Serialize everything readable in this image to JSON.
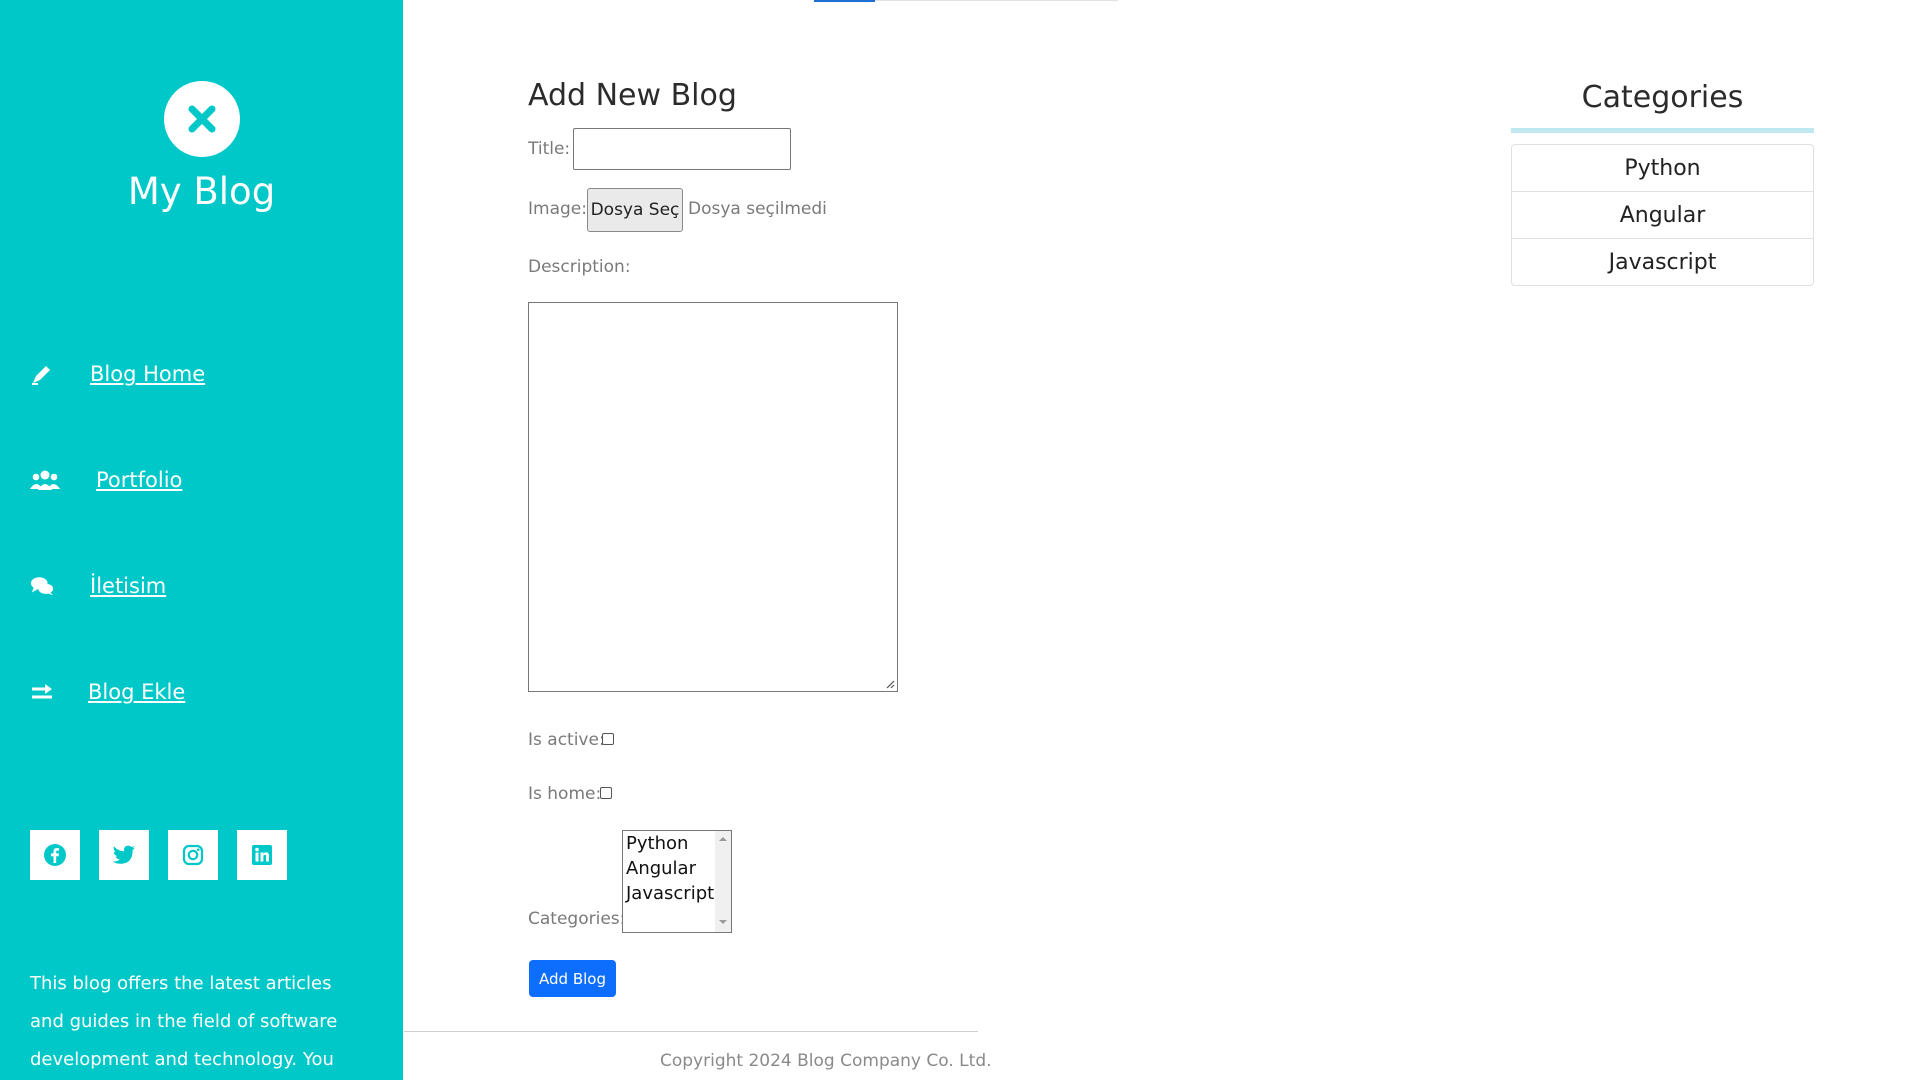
{
  "sidebar": {
    "brand": "My Blog",
    "logo_icon": "close-icon",
    "nav": [
      {
        "label": "Blog Home",
        "icon": "edit-icon"
      },
      {
        "label": "Portfolio",
        "icon": "users-icon"
      },
      {
        "label": "İletisim",
        "icon": "comments-icon"
      },
      {
        "label": "Blog Ekle",
        "icon": "arrow-right-icon"
      }
    ],
    "social": [
      "facebook-icon",
      "twitter-icon",
      "instagram-icon",
      "linkedin-icon"
    ],
    "about": "This blog offers the latest articles and guides in the field of software development and technology. You can"
  },
  "form": {
    "heading": "Add New Blog",
    "title_label": "Title:",
    "title_value": "",
    "image_label": "Image:",
    "file_button": "Dosya Seç",
    "file_status": "Dosya seçilmedi",
    "description_label": "Description:",
    "description_value": "",
    "is_active_label": "Is active:",
    "is_active": false,
    "is_home_label": "Is home:",
    "is_home": false,
    "categories_label": "Categories:",
    "category_options": [
      "Python",
      "Angular",
      "Javascript"
    ],
    "submit": "Add Blog"
  },
  "footer": {
    "copyright": "Copyright 2024 Blog Company Co. Ltd."
  },
  "categories_panel": {
    "title": "Categories",
    "items": [
      "Python",
      "Angular",
      "Javascript"
    ]
  },
  "colors": {
    "sidebar_bg": "#00c8c8",
    "primary_button": "#0d6efd",
    "category_underline": "#bfe8f0"
  }
}
